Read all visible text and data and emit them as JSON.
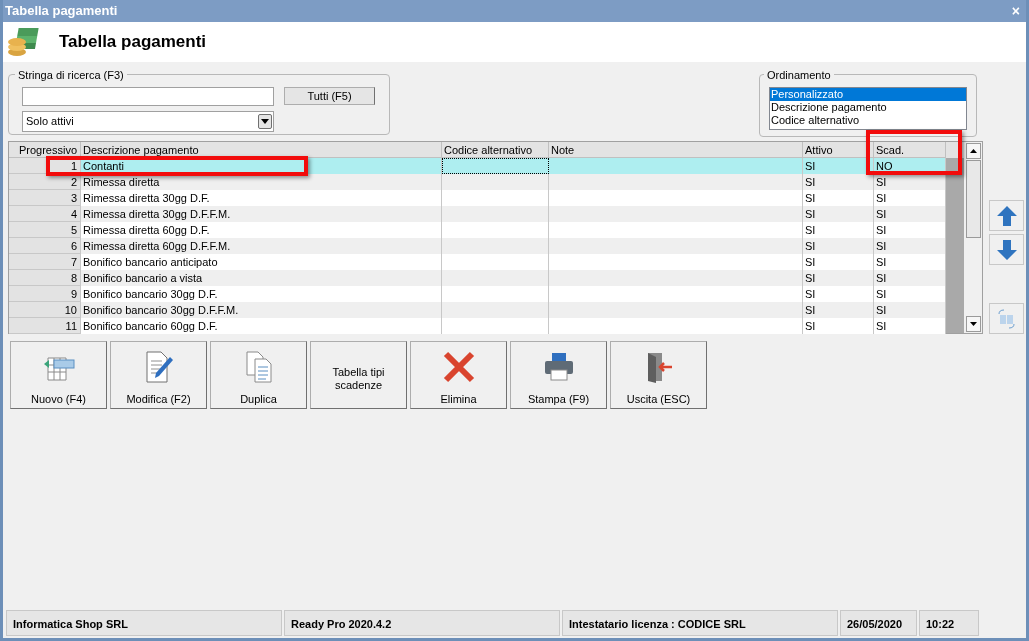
{
  "window": {
    "title": "Tabella pagamenti",
    "close": "×"
  },
  "header": {
    "title": "Tabella pagamenti"
  },
  "search": {
    "legend": "Stringa di ricerca (F3)",
    "all_button": "Tutti (F5)",
    "filter": "Solo attivi"
  },
  "ordering": {
    "legend": "Ordinamento",
    "options": [
      {
        "label": "Personalizzato",
        "selected": true
      },
      {
        "label": "Descrizione pagamento",
        "selected": false
      },
      {
        "label": "Codice alternativo",
        "selected": false
      }
    ]
  },
  "table": {
    "columns": [
      "Progressivo",
      "Descrizione pagamento",
      "Codice alternativo",
      "Note",
      "Attivo",
      "Scad."
    ],
    "rows": [
      {
        "cells": [
          "1",
          "Contanti",
          "",
          "",
          "SI",
          "NO"
        ],
        "selected": true
      },
      {
        "cells": [
          "2",
          "Rimessa diretta",
          "",
          "",
          "SI",
          "SI"
        ],
        "selected": false
      },
      {
        "cells": [
          "3",
          "Rimessa diretta 30gg D.F.",
          "",
          "",
          "SI",
          "SI"
        ],
        "selected": false
      },
      {
        "cells": [
          "4",
          "Rimessa diretta 30gg D.F.F.M.",
          "",
          "",
          "SI",
          "SI"
        ],
        "selected": false
      },
      {
        "cells": [
          "5",
          "Rimessa diretta 60gg D.F.",
          "",
          "",
          "SI",
          "SI"
        ],
        "selected": false
      },
      {
        "cells": [
          "6",
          "Rimessa diretta 60gg D.F.F.M.",
          "",
          "",
          "SI",
          "SI"
        ],
        "selected": false
      },
      {
        "cells": [
          "7",
          "Bonifico bancario anticipato",
          "",
          "",
          "SI",
          "SI"
        ],
        "selected": false
      },
      {
        "cells": [
          "8",
          "Bonifico bancario a vista",
          "",
          "",
          "SI",
          "SI"
        ],
        "selected": false
      },
      {
        "cells": [
          "9",
          "Bonifico bancario 30gg D.F.",
          "",
          "",
          "SI",
          "SI"
        ],
        "selected": false
      },
      {
        "cells": [
          "10",
          "Bonifico bancario 30gg D.F.F.M.",
          "",
          "",
          "SI",
          "SI"
        ],
        "selected": false
      },
      {
        "cells": [
          "11",
          "Bonifico bancario 60gg D.F.",
          "",
          "",
          "SI",
          "SI"
        ],
        "selected": false
      }
    ]
  },
  "buttons": [
    {
      "label": "Nuovo (F4)",
      "kind": "new"
    },
    {
      "label": "Modifica (F2)",
      "kind": "edit"
    },
    {
      "label": "Duplica",
      "kind": "copy"
    },
    {
      "label": "Tabella tipi scadenze",
      "kind": "text"
    },
    {
      "label": "Elimina",
      "kind": "delete"
    },
    {
      "label": "Stampa (F9)",
      "kind": "print"
    },
    {
      "label": "Uscita (ESC)",
      "kind": "exit"
    }
  ],
  "status_bar": [
    "Informatica Shop SRL",
    "Ready Pro 2020.4.2",
    "Intestatario licenza : CODICE SRL",
    "26/05/2020",
    "10:22"
  ]
}
